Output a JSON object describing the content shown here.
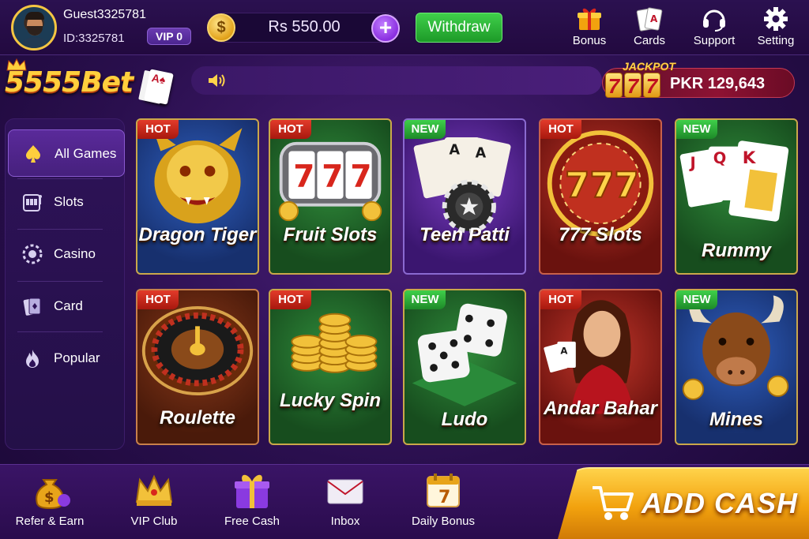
{
  "user": {
    "name": "Guest3325781",
    "id_label": "ID:3325781",
    "vip": "VIP 0"
  },
  "wallet": {
    "currency_symbol": "$",
    "balance": "Rs 550.00",
    "plus": "+",
    "withdraw_label": "Withdraw"
  },
  "top_actions": [
    {
      "label": "Bonus",
      "icon": "gift-icon"
    },
    {
      "label": "Cards",
      "icon": "cards-icon"
    },
    {
      "label": "Support",
      "icon": "headset-icon"
    },
    {
      "label": "Setting",
      "icon": "gear-icon"
    }
  ],
  "brand": {
    "logo": "5555Bet",
    "card_glyph": "A♠"
  },
  "jackpot": {
    "label": "JACKPOT",
    "reels": [
      "7",
      "7",
      "7"
    ],
    "amount": "PKR 129,643"
  },
  "sidebar": {
    "items": [
      {
        "label": "All Games",
        "icon": "spade-icon",
        "active": true
      },
      {
        "label": "Slots",
        "icon": "slot-machine-icon",
        "active": false
      },
      {
        "label": "Casino",
        "icon": "chip-icon",
        "active": false
      },
      {
        "label": "Card",
        "icon": "card-icon",
        "active": false
      },
      {
        "label": "Popular",
        "icon": "flame-icon",
        "active": false
      }
    ]
  },
  "games": [
    {
      "title": "Dragon Tiger",
      "tag": "HOT",
      "art": "dragon"
    },
    {
      "title": "Fruit Slots",
      "tag": "HOT",
      "art": "slot-reels"
    },
    {
      "title": "Teen Patti",
      "tag": "NEW",
      "art": "playing-cards"
    },
    {
      "title": "777 Slots",
      "tag": "HOT",
      "art": "777-wheel"
    },
    {
      "title": "Rummy",
      "tag": "NEW",
      "art": "jqk-cards"
    },
    {
      "title": "Roulette",
      "tag": "HOT",
      "art": "roulette-wheel"
    },
    {
      "title": "Lucky Spin",
      "tag": "HOT",
      "art": "coin-stacks"
    },
    {
      "title": "Ludo",
      "tag": "NEW",
      "art": "dice"
    },
    {
      "title": "Andar Bahar",
      "tag": "HOT",
      "art": "woman-with-cards"
    },
    {
      "title": "Mines",
      "tag": "NEW",
      "art": "bull"
    }
  ],
  "bottom_nav": [
    {
      "label": "Refer & Earn",
      "icon": "money-bag-icon"
    },
    {
      "label": "VIP Club",
      "icon": "crown-icon"
    },
    {
      "label": "Free Cash",
      "icon": "gift-box-icon"
    },
    {
      "label": "Inbox",
      "icon": "envelope-icon"
    },
    {
      "label": "Daily Bonus",
      "icon": "calendar-icon",
      "calendar_day": "7"
    }
  ],
  "add_cash": {
    "label": "ADD CASH",
    "icon": "cart-icon"
  },
  "colors": {
    "gold": "#ffcf3d",
    "green": "#3fcf4a",
    "hot_red": "#e23b2a",
    "background_purple": "#2a0f4e"
  }
}
